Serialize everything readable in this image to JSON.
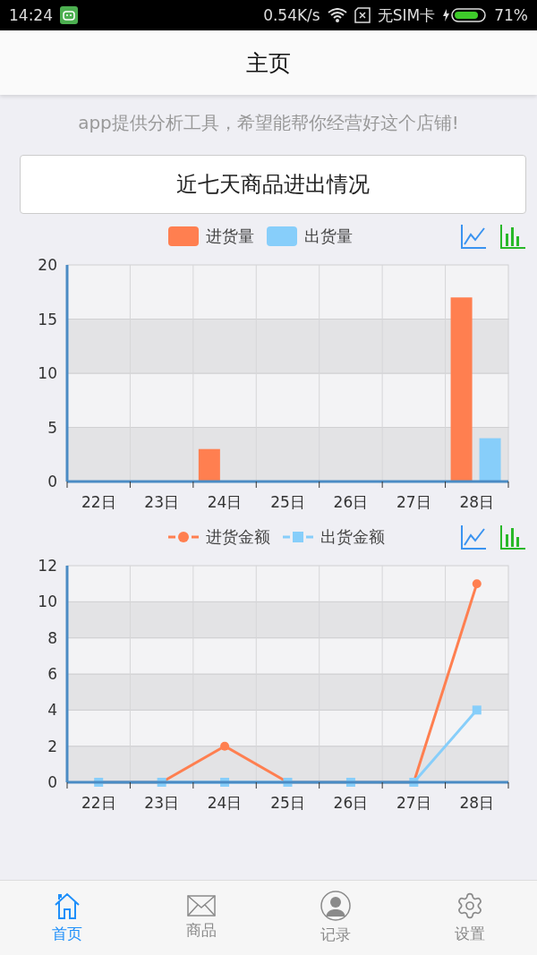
{
  "status_bar": {
    "time": "14:24",
    "net_speed": "0.54K/s",
    "sim": "无SIM卡",
    "battery": "71%"
  },
  "header": {
    "title": "主页"
  },
  "tagline": "app提供分析工具，希望能帮你经营好这个店铺!",
  "section_button": "近七天商品进出情况",
  "charts": [
    {
      "chart_data": {
        "type": "bar",
        "categories": [
          "22日",
          "23日",
          "24日",
          "25日",
          "26日",
          "27日",
          "28日"
        ],
        "ylim": [
          0,
          20
        ],
        "yticks": [
          0,
          5,
          10,
          15,
          20
        ],
        "series": [
          {
            "name": "进货量",
            "color": "#ff7f50",
            "values": [
              0,
              0,
              3,
              0,
              0,
              0,
              17
            ]
          },
          {
            "name": "出货量",
            "color": "#87cefa",
            "values": [
              0,
              0,
              0,
              0,
              0,
              0,
              4
            ]
          }
        ]
      }
    },
    {
      "chart_data": {
        "type": "line",
        "categories": [
          "22日",
          "23日",
          "24日",
          "25日",
          "26日",
          "27日",
          "28日"
        ],
        "ylim": [
          0,
          12
        ],
        "yticks": [
          0,
          2,
          4,
          6,
          8,
          10,
          12
        ],
        "series": [
          {
            "name": "进货金额",
            "color": "#ff7f50",
            "marker": "circle",
            "values": [
              0,
              0,
              2,
              0,
              0,
              0,
              11
            ]
          },
          {
            "name": "出货金额",
            "color": "#87cefa",
            "marker": "square",
            "values": [
              0,
              0,
              0,
              0,
              0,
              0,
              4
            ]
          }
        ]
      }
    }
  ],
  "tab_bar": [
    {
      "kind": "home",
      "label": "首页",
      "selected": true
    },
    {
      "kind": "mail",
      "label": "商品",
      "selected": false
    },
    {
      "kind": "user",
      "label": "记录",
      "selected": false
    },
    {
      "kind": "gear",
      "label": "设置",
      "selected": false
    }
  ]
}
